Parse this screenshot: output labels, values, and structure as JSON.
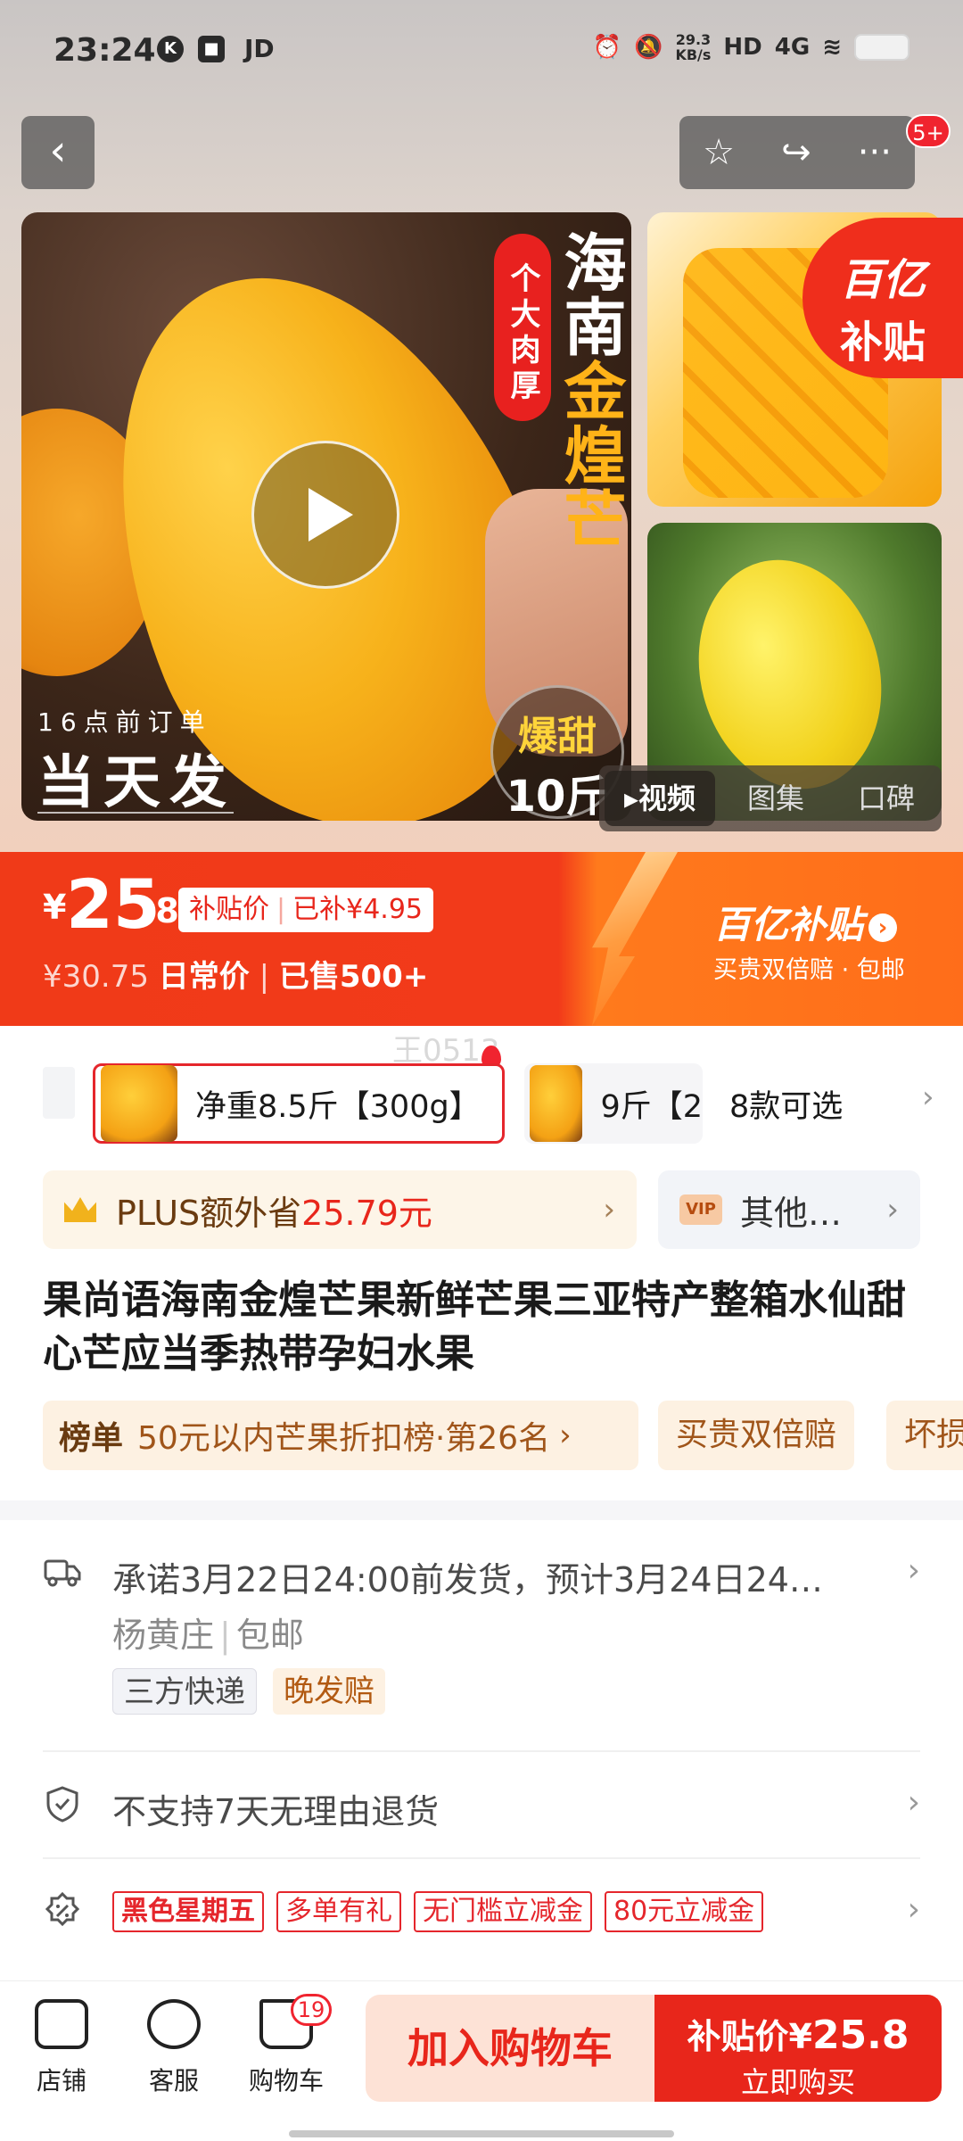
{
  "status_bar": {
    "time": "23:24",
    "left_icons": [
      "K",
      "■"
    ],
    "carrier": "JD",
    "speed_value": "29.3",
    "speed_unit": "KB/s",
    "hd": "HD",
    "network": "4G"
  },
  "nav": {
    "back": "‹",
    "favorite": "☆",
    "share": "↪",
    "more": "···",
    "badge": "5+"
  },
  "gallery": {
    "main_vertical_red": "个大肉厚",
    "main_vertical_white": "海南",
    "main_vertical_orange": "金煌芒",
    "caption_small": "16点前订单",
    "caption_big": "当天发",
    "sweet_line1": "爆甜",
    "sweet_line2": "10斤",
    "subsidy_badge_line1": "百亿",
    "subsidy_badge_line2": "补贴",
    "media_tabs": [
      "▸视频",
      "图集",
      "口碑"
    ]
  },
  "price": {
    "currency": "¥",
    "integer": "25",
    "decimal": ".8",
    "tag_label": "补贴价",
    "tag_saved": "已补¥4.95",
    "original": "¥30.75",
    "daily_label": "日常价",
    "sold": "已售500+",
    "banner_title": "百亿补贴",
    "banner_arrow": "›",
    "banner_sub": "买贵双倍赔 · 包邮"
  },
  "specs": {
    "watermark": "王0513",
    "selected": "净重8.5斤【300g】",
    "other": "9斤【2",
    "more": "8款可选",
    "chevron": "›"
  },
  "plus": {
    "prefix": "PLUS额外省",
    "amount": "25.79元",
    "chevron": "›",
    "vip": "VIP",
    "other": "其他…",
    "other_chevron": "›"
  },
  "product_title": "果尚语海南金煌芒果新鲜芒果三亚特产整箱水仙甜心芒应当季热带孕妇水果",
  "ranking": {
    "label": "榜单",
    "text": "50元以内芒果折扣榜·第26名",
    "chevron": "›",
    "pills": [
      "买贵双倍赔",
      "坏损"
    ]
  },
  "shipping": {
    "main": "承诺3月22日24:00前发货，预计3月24日24…",
    "from": "杨黄庄",
    "free": "包邮",
    "tags": [
      "三方快递",
      "晚发赔"
    ],
    "chevron": "›"
  },
  "returns": {
    "text": "不支持7天无理由退货",
    "chevron": "›"
  },
  "promos": {
    "tags": [
      "黑色星期五",
      "多单有礼",
      "无门槛立减金",
      "80元立减金"
    ],
    "chevron": "›"
  },
  "bottom_bar": {
    "store": "店铺",
    "service": "客服",
    "cart": "购物车",
    "cart_count": "19",
    "add_to_cart": "加入购物车",
    "buy_prefix": "补贴价¥",
    "buy_price": "25.8",
    "buy_now": "立即购买"
  },
  "colors": {
    "accent_red": "#e8261b",
    "banner_orange": "#ff7a1c",
    "plus_bg": "#fdf5e8"
  }
}
